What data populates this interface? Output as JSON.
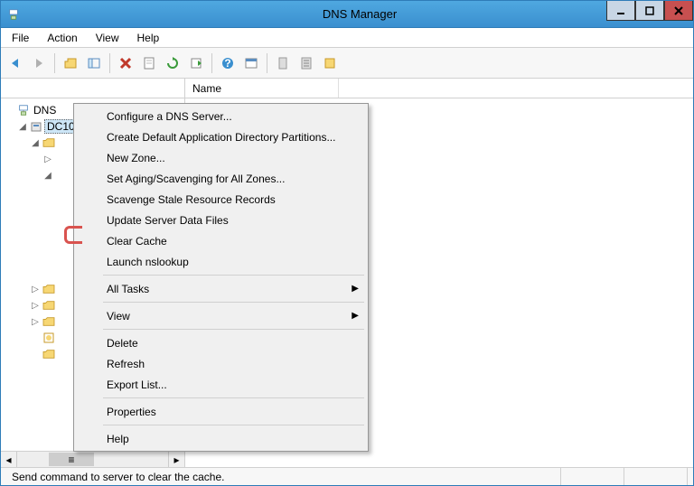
{
  "window": {
    "title": "DNS Manager"
  },
  "menu": {
    "file": "File",
    "action": "Action",
    "view": "View",
    "help": "Help"
  },
  "tree": {
    "root": "DNS",
    "server": "DC10"
  },
  "list": {
    "name_col": "Name"
  },
  "context": {
    "configure": "Configure a DNS Server...",
    "create_partitions": "Create Default Application Directory Partitions...",
    "new_zone": "New Zone...",
    "aging": "Set Aging/Scavenging for All Zones...",
    "scavenge": "Scavenge Stale Resource Records",
    "update": "Update Server Data Files",
    "clear_cache": "Clear Cache",
    "nslookup": "Launch nslookup",
    "all_tasks": "All Tasks",
    "view": "View",
    "delete": "Delete",
    "refresh": "Refresh",
    "export": "Export List...",
    "properties": "Properties",
    "help": "Help"
  },
  "status": {
    "text": "Send command to server to clear the cache."
  }
}
